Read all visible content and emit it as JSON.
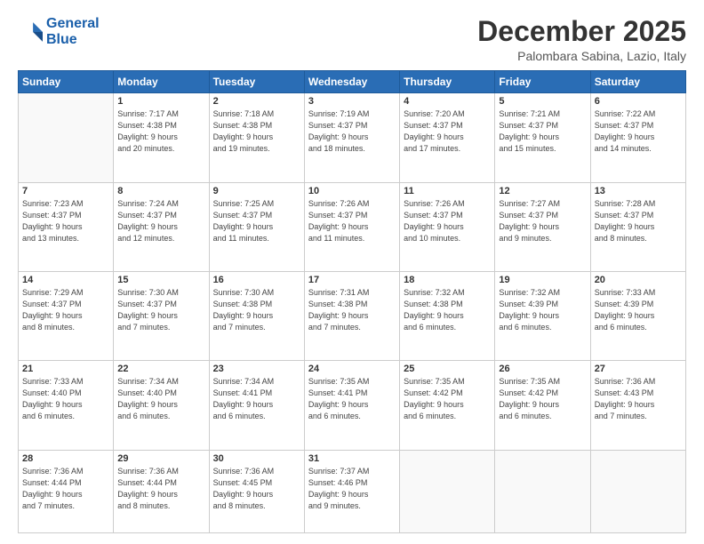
{
  "logo": {
    "line1": "General",
    "line2": "Blue"
  },
  "title": "December 2025",
  "subtitle": "Palombara Sabina, Lazio, Italy",
  "header_days": [
    "Sunday",
    "Monday",
    "Tuesday",
    "Wednesday",
    "Thursday",
    "Friday",
    "Saturday"
  ],
  "weeks": [
    [
      {
        "day": "",
        "info": ""
      },
      {
        "day": "1",
        "info": "Sunrise: 7:17 AM\nSunset: 4:38 PM\nDaylight: 9 hours\nand 20 minutes."
      },
      {
        "day": "2",
        "info": "Sunrise: 7:18 AM\nSunset: 4:38 PM\nDaylight: 9 hours\nand 19 minutes."
      },
      {
        "day": "3",
        "info": "Sunrise: 7:19 AM\nSunset: 4:37 PM\nDaylight: 9 hours\nand 18 minutes."
      },
      {
        "day": "4",
        "info": "Sunrise: 7:20 AM\nSunset: 4:37 PM\nDaylight: 9 hours\nand 17 minutes."
      },
      {
        "day": "5",
        "info": "Sunrise: 7:21 AM\nSunset: 4:37 PM\nDaylight: 9 hours\nand 15 minutes."
      },
      {
        "day": "6",
        "info": "Sunrise: 7:22 AM\nSunset: 4:37 PM\nDaylight: 9 hours\nand 14 minutes."
      }
    ],
    [
      {
        "day": "7",
        "info": "Sunrise: 7:23 AM\nSunset: 4:37 PM\nDaylight: 9 hours\nand 13 minutes."
      },
      {
        "day": "8",
        "info": "Sunrise: 7:24 AM\nSunset: 4:37 PM\nDaylight: 9 hours\nand 12 minutes."
      },
      {
        "day": "9",
        "info": "Sunrise: 7:25 AM\nSunset: 4:37 PM\nDaylight: 9 hours\nand 11 minutes."
      },
      {
        "day": "10",
        "info": "Sunrise: 7:26 AM\nSunset: 4:37 PM\nDaylight: 9 hours\nand 11 minutes."
      },
      {
        "day": "11",
        "info": "Sunrise: 7:26 AM\nSunset: 4:37 PM\nDaylight: 9 hours\nand 10 minutes."
      },
      {
        "day": "12",
        "info": "Sunrise: 7:27 AM\nSunset: 4:37 PM\nDaylight: 9 hours\nand 9 minutes."
      },
      {
        "day": "13",
        "info": "Sunrise: 7:28 AM\nSunset: 4:37 PM\nDaylight: 9 hours\nand 8 minutes."
      }
    ],
    [
      {
        "day": "14",
        "info": "Sunrise: 7:29 AM\nSunset: 4:37 PM\nDaylight: 9 hours\nand 8 minutes."
      },
      {
        "day": "15",
        "info": "Sunrise: 7:30 AM\nSunset: 4:37 PM\nDaylight: 9 hours\nand 7 minutes."
      },
      {
        "day": "16",
        "info": "Sunrise: 7:30 AM\nSunset: 4:38 PM\nDaylight: 9 hours\nand 7 minutes."
      },
      {
        "day": "17",
        "info": "Sunrise: 7:31 AM\nSunset: 4:38 PM\nDaylight: 9 hours\nand 7 minutes."
      },
      {
        "day": "18",
        "info": "Sunrise: 7:32 AM\nSunset: 4:38 PM\nDaylight: 9 hours\nand 6 minutes."
      },
      {
        "day": "19",
        "info": "Sunrise: 7:32 AM\nSunset: 4:39 PM\nDaylight: 9 hours\nand 6 minutes."
      },
      {
        "day": "20",
        "info": "Sunrise: 7:33 AM\nSunset: 4:39 PM\nDaylight: 9 hours\nand 6 minutes."
      }
    ],
    [
      {
        "day": "21",
        "info": "Sunrise: 7:33 AM\nSunset: 4:40 PM\nDaylight: 9 hours\nand 6 minutes."
      },
      {
        "day": "22",
        "info": "Sunrise: 7:34 AM\nSunset: 4:40 PM\nDaylight: 9 hours\nand 6 minutes."
      },
      {
        "day": "23",
        "info": "Sunrise: 7:34 AM\nSunset: 4:41 PM\nDaylight: 9 hours\nand 6 minutes."
      },
      {
        "day": "24",
        "info": "Sunrise: 7:35 AM\nSunset: 4:41 PM\nDaylight: 9 hours\nand 6 minutes."
      },
      {
        "day": "25",
        "info": "Sunrise: 7:35 AM\nSunset: 4:42 PM\nDaylight: 9 hours\nand 6 minutes."
      },
      {
        "day": "26",
        "info": "Sunrise: 7:35 AM\nSunset: 4:42 PM\nDaylight: 9 hours\nand 6 minutes."
      },
      {
        "day": "27",
        "info": "Sunrise: 7:36 AM\nSunset: 4:43 PM\nDaylight: 9 hours\nand 7 minutes."
      }
    ],
    [
      {
        "day": "28",
        "info": "Sunrise: 7:36 AM\nSunset: 4:44 PM\nDaylight: 9 hours\nand 7 minutes."
      },
      {
        "day": "29",
        "info": "Sunrise: 7:36 AM\nSunset: 4:44 PM\nDaylight: 9 hours\nand 8 minutes."
      },
      {
        "day": "30",
        "info": "Sunrise: 7:36 AM\nSunset: 4:45 PM\nDaylight: 9 hours\nand 8 minutes."
      },
      {
        "day": "31",
        "info": "Sunrise: 7:37 AM\nSunset: 4:46 PM\nDaylight: 9 hours\nand 9 minutes."
      },
      {
        "day": "",
        "info": ""
      },
      {
        "day": "",
        "info": ""
      },
      {
        "day": "",
        "info": ""
      }
    ]
  ]
}
